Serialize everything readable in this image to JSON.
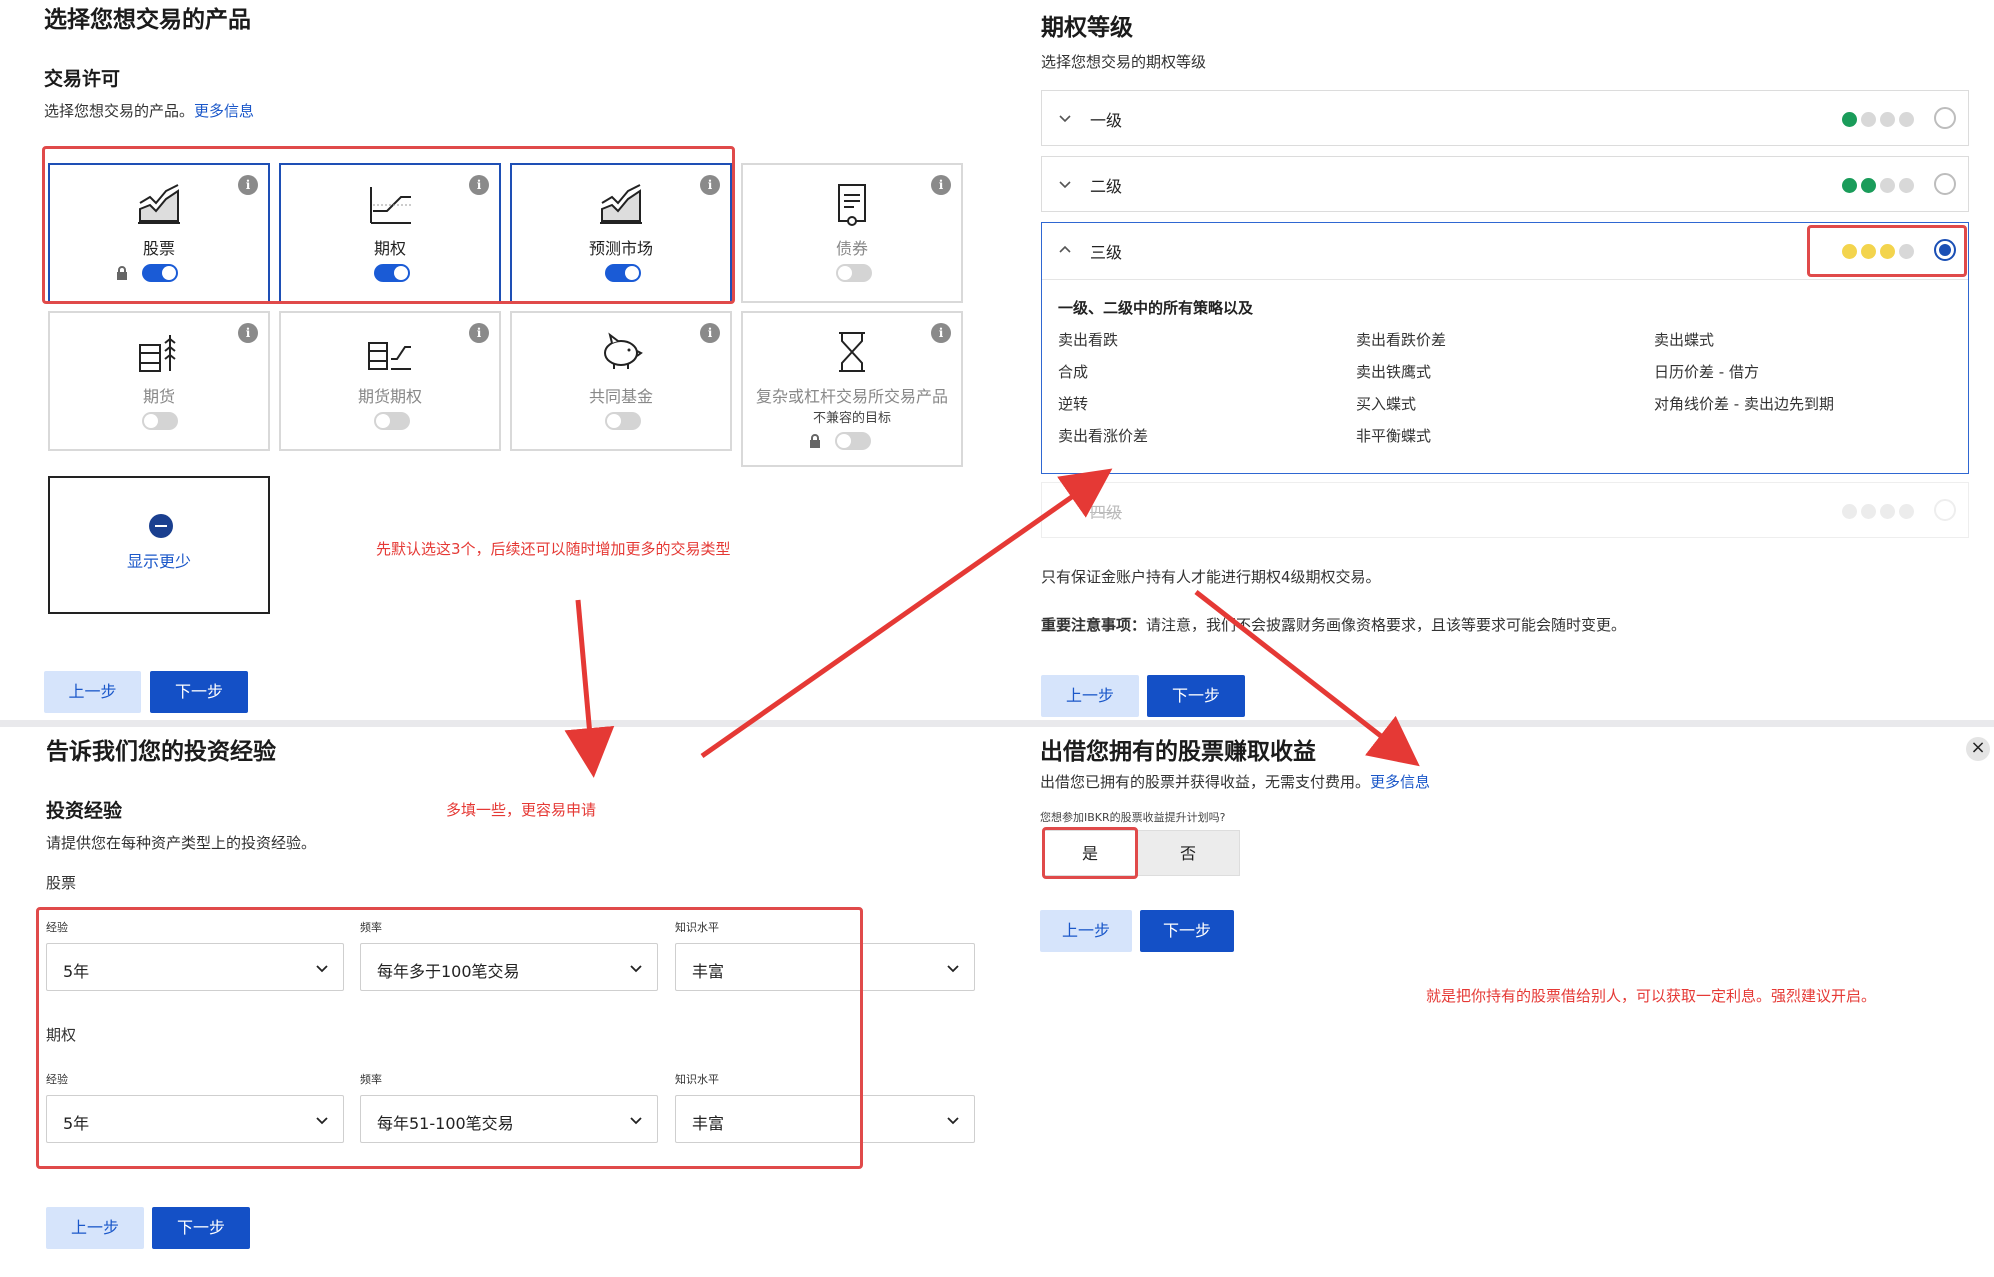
{
  "p1": {
    "title": "选择您想交易的产品",
    "section": "交易许可",
    "desc": "选择您想交易的产品。",
    "more": "更多信息",
    "cards": [
      {
        "label": "股票"
      },
      {
        "label": "期权"
      },
      {
        "label": "预测市场"
      },
      {
        "label": "债券"
      },
      {
        "label": "期货"
      },
      {
        "label": "期货期权"
      },
      {
        "label": "共同基金"
      },
      {
        "label": "复杂或杠杆交易所交易产品",
        "sub": "不兼容的目标"
      }
    ],
    "info_glyph": "i",
    "show_less": "显示更少",
    "note": "先默认选这3个，后续还可以随时增加更多的交易类型",
    "prev": "上一步",
    "next": "下一步"
  },
  "p2": {
    "title": "期权等级",
    "desc": "选择您想交易的期权等级",
    "levels": [
      "一级",
      "二级",
      "三级",
      "四级"
    ],
    "level3_intro": "一级、二级中的所有策略以及",
    "strategies": [
      [
        "卖出看跌",
        "卖出看跌价差",
        "卖出蝶式"
      ],
      [
        "合成",
        "卖出铁鹰式",
        "日历价差 - 借方"
      ],
      [
        "逆转",
        "买入蝶式",
        "对角线价差 - 卖出边先到期"
      ],
      [
        "卖出看涨价差",
        "非平衡蝶式",
        ""
      ]
    ],
    "note1": "只有保证金账户持有人才能进行期权4级期权交易。",
    "note2_label": "重要注意事项：",
    "note2": "请注意，我们不会披露财务画像资格要求，且该等要求可能会随时变更。",
    "prev": "上一步",
    "next": "下一步"
  },
  "p3": {
    "title": "告诉我们您的投资经验",
    "section": "投资经验",
    "note": "多填一些，更容易申请",
    "desc": "请提供您在每种资产类型上的投资经验。",
    "groups": [
      {
        "name": "股票",
        "exp_label": "经验",
        "exp": "5年",
        "freq_label": "频率",
        "freq": "每年多于100笔交易",
        "know_label": "知识水平",
        "know": "丰富"
      },
      {
        "name": "期权",
        "exp_label": "经验",
        "exp": "5年",
        "freq_label": "频率",
        "freq": "每年51-100笔交易",
        "know_label": "知识水平",
        "know": "丰富"
      }
    ],
    "prev": "上一步",
    "next": "下一步"
  },
  "p4": {
    "title": "出借您拥有的股票赚取收益",
    "desc": "出借您已拥有的股票并获得收益，无需支付费用。",
    "more": "更多信息",
    "question": "您想参加IBKR的股票收益提升计划吗?",
    "yes": "是",
    "no": "否",
    "close_glyph": "×",
    "prev": "上一步",
    "next": "下一步",
    "note": "就是把你持有的股票借给别人，可以获取一定利息。强烈建议开启。"
  },
  "colors": {
    "accent": "#1450c6",
    "annotation": "#e53935",
    "level2_dots": "#1a9c5a",
    "level3_dots": "#f3d44d"
  }
}
